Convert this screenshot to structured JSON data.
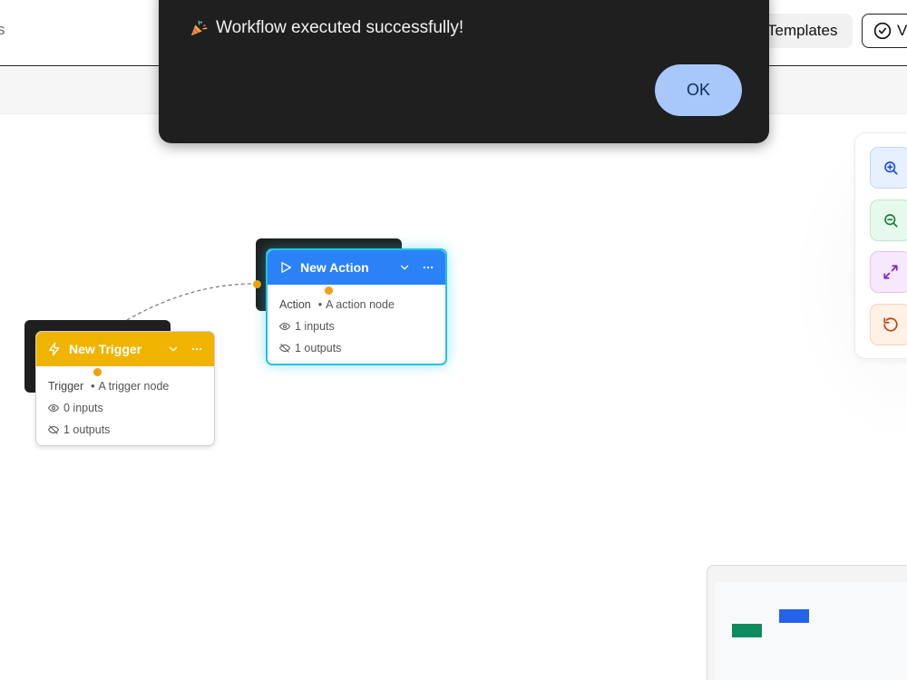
{
  "header": {
    "left_text": "s",
    "templates_label": "Templates",
    "validate_label": "V"
  },
  "nodes": {
    "trigger": {
      "title": "New Trigger",
      "type": "Trigger",
      "description": "A trigger node",
      "inputs": "0 inputs",
      "outputs": "1 outputs",
      "color": "#f0b400"
    },
    "action": {
      "title": "New Action",
      "type": "Action",
      "description": "A action node",
      "inputs": "1 inputs",
      "outputs": "1 outputs",
      "color": "#2b82f6"
    }
  },
  "zoom_controls": {
    "icons": [
      "zoom-in-icon",
      "zoom-out-icon",
      "fit-view-icon",
      "reset-icon"
    ]
  },
  "minimap": {
    "nodes": [
      {
        "name": "trigger",
        "color": "#0f8a5f"
      },
      {
        "name": "action",
        "color": "#2563eb"
      }
    ]
  },
  "dialog": {
    "message": "Workflow executed successfully!",
    "ok_label": "OK"
  }
}
